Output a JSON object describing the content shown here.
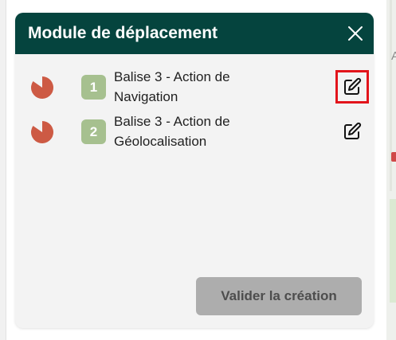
{
  "backdrop": {
    "map_text": "A"
  },
  "modal": {
    "title": "Module de déplacement",
    "close_icon": "close-icon",
    "header_color": "#05443e"
  },
  "steps": [
    {
      "number": "1",
      "label_line1": "Balise 3 - Action de",
      "label_line2": "Navigation",
      "status_icon": "pie-icon",
      "action_icon": "edit-icon",
      "highlighted": true
    },
    {
      "number": "2",
      "label_line1": "Balise 3 - Action de",
      "label_line2": "Géolocalisation",
      "status_icon": "pie-icon",
      "action_icon": "edit-icon",
      "highlighted": false
    }
  ],
  "footer": {
    "submit_label": "Valider la création",
    "submit_enabled": false
  },
  "colors": {
    "badge": "#a6c08f",
    "pie": "#cd5a44",
    "highlight": "#e2141b",
    "disabled_button": "#adadad"
  }
}
